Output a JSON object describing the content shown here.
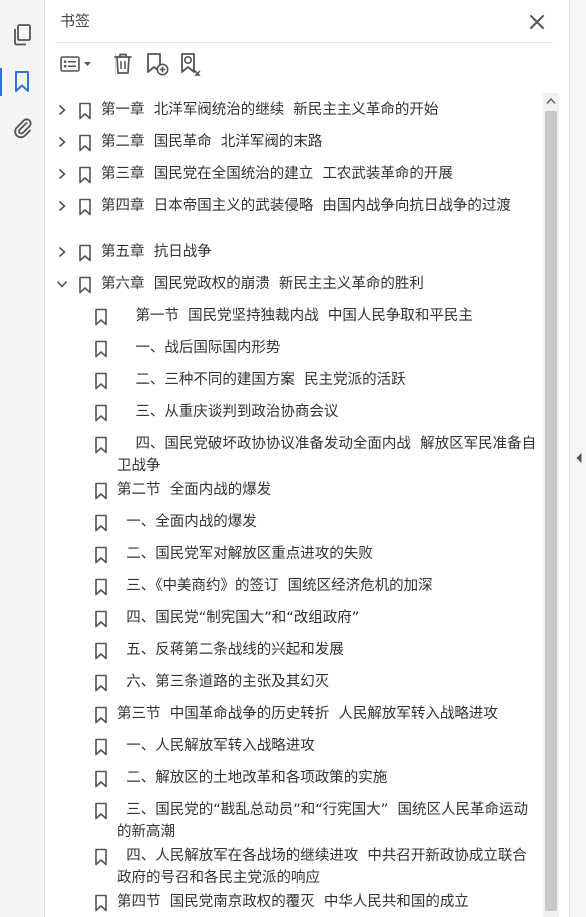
{
  "panel": {
    "title": "书签"
  },
  "colors": {
    "icon": "#555555",
    "accent": "#2d74d6",
    "text": "#333333"
  },
  "rail": {
    "items": [
      {
        "icon": "pages-icon"
      },
      {
        "icon": "bookmark-icon",
        "active": true
      },
      {
        "icon": "attachment-icon"
      }
    ]
  },
  "toolbar": {
    "items": [
      {
        "icon": "options-menu-icon"
      },
      {
        "icon": "delete-icon"
      },
      {
        "icon": "new-bookmark-icon"
      },
      {
        "icon": "find-bookmark-icon"
      }
    ]
  },
  "bookmarks": [
    {
      "label": "第一章  北洋军阀统治的继续  新民主主义革命的开始",
      "expander": "collapsed"
    },
    {
      "label": "第二章  国民革命  北洋军阀的末路",
      "expander": "collapsed"
    },
    {
      "label": "第三章  国民党在全国统治的建立  工农武装革命的开展",
      "expander": "collapsed"
    },
    {
      "label": "第四章  日本帝国主义的武装侵略  由国内战争向抗日战争的过渡",
      "expander": "collapsed"
    },
    {
      "label": "第五章  抗日战争",
      "expander": "collapsed"
    },
    {
      "label": "第六章  国民党政权的崩溃  新民主主义革命的胜利",
      "expander": "expanded"
    },
    {
      "label": "    第一节  国民党坚持独裁内战  中国人民争取和平民主",
      "expander": "none"
    },
    {
      "label": "    一、战后国际国内形势",
      "expander": "none"
    },
    {
      "label": "    二、三种不同的建国方案  民主党派的活跃",
      "expander": "none"
    },
    {
      "label": "    三、从重庆谈判到政治协商会议",
      "expander": "none"
    },
    {
      "label": "    四、国民党破坏政协协议准备发动全面内战  解放区军民准备自卫战争",
      "expander": "none"
    },
    {
      "label": "第二节  全面内战的爆发",
      "expander": "none"
    },
    {
      "label": "  一、全面内战的爆发",
      "expander": "none"
    },
    {
      "label": "  二、国民党军对解放区重点进攻的失败",
      "expander": "none"
    },
    {
      "label": "  三、《中美商约》的签订  国统区经济危机的加深",
      "expander": "none"
    },
    {
      "label": "  四、国民党“制宪国大”和“改组政府”",
      "expander": "none"
    },
    {
      "label": "  五、反蒋第二条战线的兴起和发展",
      "expander": "none"
    },
    {
      "label": "  六、第三条道路的主张及其幻灭",
      "expander": "none"
    },
    {
      "label": "第三节  中国革命战争的历史转折  人民解放军转入战略进攻",
      "expander": "none"
    },
    {
      "label": "  一、人民解放军转入战略进攻",
      "expander": "none"
    },
    {
      "label": "  二、解放区的土地改革和各项政策的实施",
      "expander": "none"
    },
    {
      "label": "  三、国民党的“戡乱总动员”和“行宪国大”  国统区人民革命运动的新高潮",
      "expander": "none"
    },
    {
      "label": "  四、人民解放军在各战场的继续进攻  中共召开新政协成立联合政府的号召和各民主党派的响应",
      "expander": "none"
    },
    {
      "label": "第四节  国民党南京政权的覆灭  中华人民共和国的成立",
      "expander": "none"
    }
  ]
}
